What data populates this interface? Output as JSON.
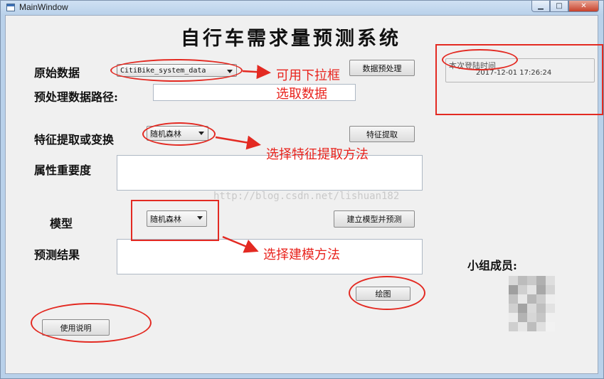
{
  "window": {
    "title": "MainWindow"
  },
  "header": {
    "title": "自行车需求量预测系统"
  },
  "raw_data": {
    "label": "原始数据",
    "selected": "CitiBike_system_data",
    "button": "数据预处理"
  },
  "preprocess_path": {
    "label": "预处理数据路径:",
    "value": ""
  },
  "feature": {
    "label": "特征提取或变换",
    "selected": "随机森林",
    "button": "特征提取"
  },
  "importance": {
    "label": "属性重要度",
    "value": ""
  },
  "model": {
    "label": "模型",
    "selected": "随机森林",
    "button": "建立模型并预测"
  },
  "result": {
    "label": "预测结果",
    "value": ""
  },
  "plot_button": "绘图",
  "help_button": "使用说明",
  "login": {
    "caption": "本次登陆时间",
    "time": "2017-12-01 17:26:24"
  },
  "team": {
    "label": "小组成员:"
  },
  "annotations": {
    "dropdown_note_1": "可用下拉框",
    "dropdown_note_2": "选取数据",
    "feature_note": "选择特征提取方法",
    "model_note": "选择建模方法"
  },
  "watermark": "http://blog.csdn.net/lishuan182",
  "colors": {
    "annotation_red": "#e32a22",
    "titlebar": "#b9d1ea",
    "client_bg": "#f0f0f0"
  }
}
